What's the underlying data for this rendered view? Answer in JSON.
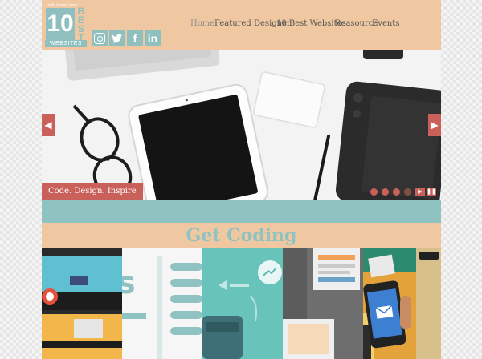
{
  "logo": {
    "tagline": "Daily Design Inspo",
    "number": "10",
    "best": "BEST",
    "websites": "WEBSITES"
  },
  "social": [
    {
      "name": "instagram"
    },
    {
      "name": "twitter",
      "glyph": "t"
    },
    {
      "name": "facebook",
      "glyph": "f"
    },
    {
      "name": "linkedin",
      "glyph": "in"
    }
  ],
  "nav": {
    "items": [
      "Home",
      "Featured Designer",
      "10 Best Websites",
      "Reasource",
      "Events"
    ],
    "active": "Home"
  },
  "slider": {
    "caption": "Code. Design. Inspire",
    "prev": "◀",
    "next": "▶"
  },
  "cta": {
    "title": "Get Coding"
  },
  "colors": {
    "header": "#efc7a1",
    "accent": "#8fc3c1",
    "red": "#c9605a"
  }
}
